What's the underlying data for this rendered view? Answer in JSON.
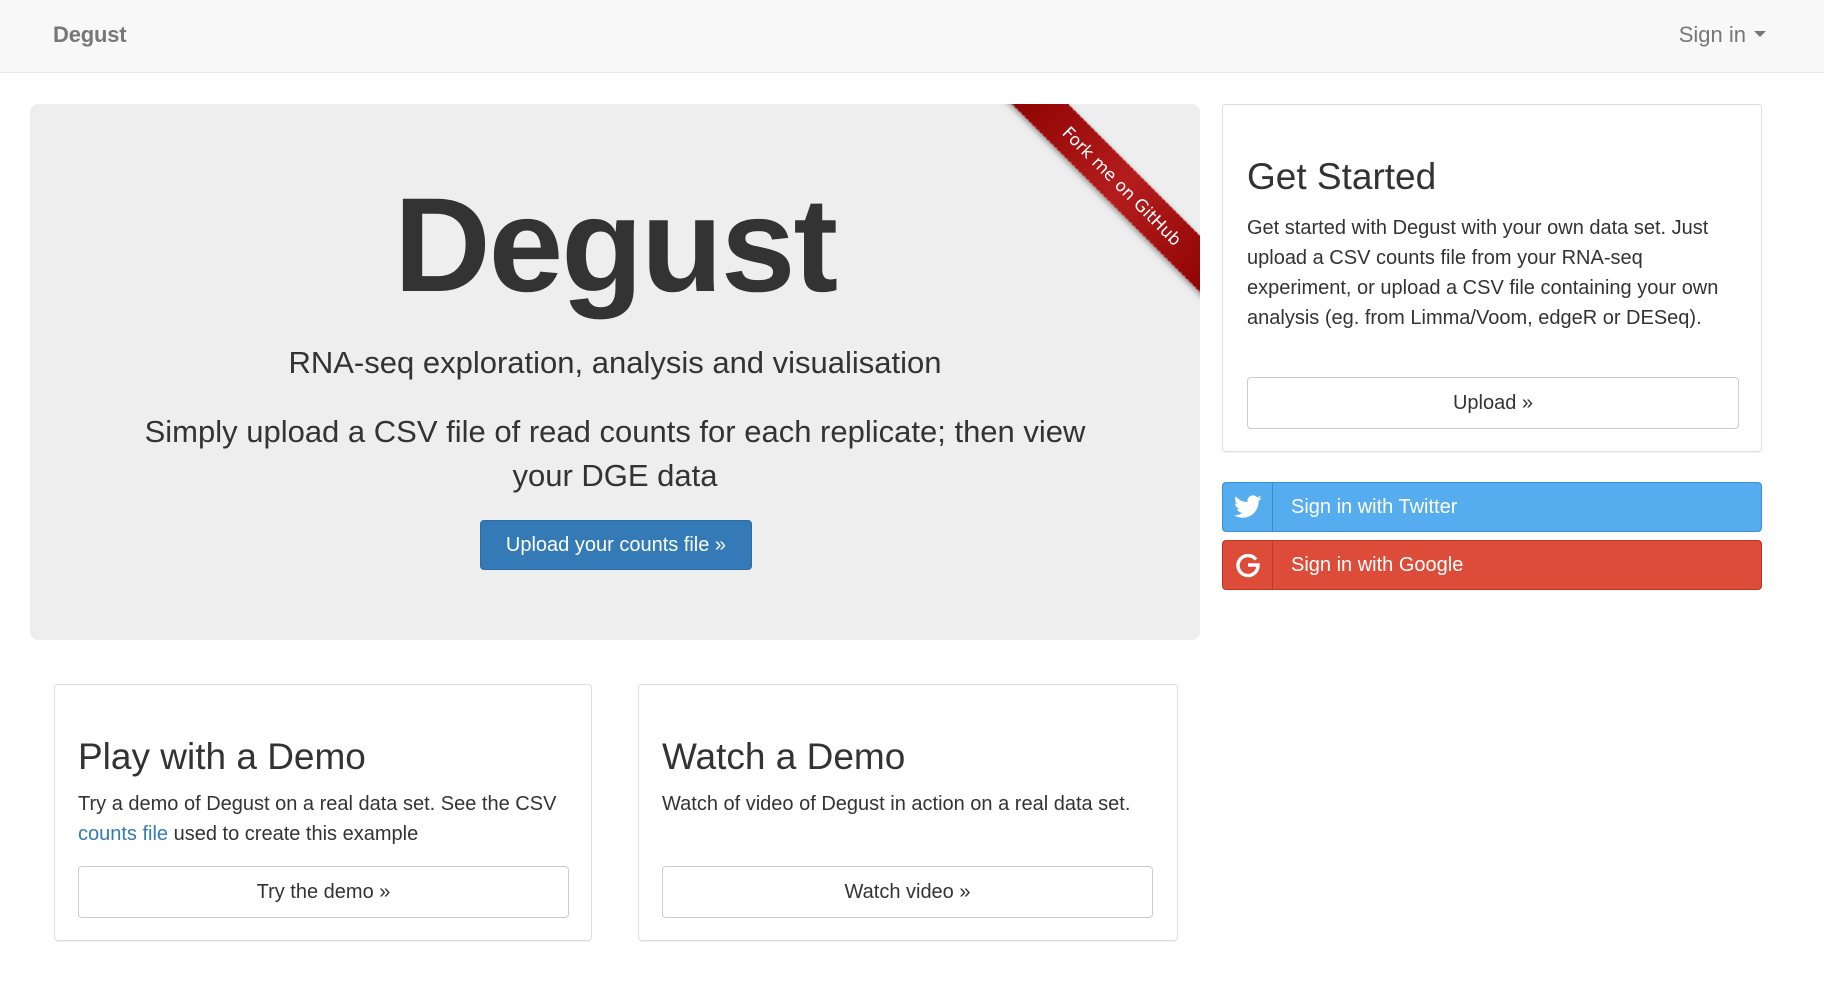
{
  "navbar": {
    "brand": "Degust",
    "signin_label": "Sign in"
  },
  "jumbotron": {
    "title": "Degust",
    "subtitle": "RNA-seq exploration, analysis and visualisation",
    "description": "Simply upload a CSV file of read counts for each replicate; then view your DGE data",
    "upload_button": "Upload your counts file »",
    "ribbon": "Fork me on GitHub"
  },
  "get_started": {
    "title": "Get Started",
    "text": "Get started with Degust with your own data set. Just upload a CSV counts file from your RNA-seq experiment, or upload a CSV file containing your own analysis (eg. from Limma/Voom, edgeR or DESeq).",
    "button": "Upload »"
  },
  "social": {
    "twitter_label": "Sign in with Twitter",
    "google_label": "Sign in with Google"
  },
  "play_demo": {
    "title": "Play with a Demo",
    "text_before": "Try a demo of Degust on a real data set. See the CSV ",
    "link": "counts file",
    "text_after": " used to create this example",
    "button": "Try the demo »"
  },
  "watch_demo": {
    "title": "Watch a Demo",
    "text": "Watch of video of Degust in action on a real data set.",
    "button": "Watch video »"
  },
  "colors": {
    "primary": "#337ab7",
    "twitter": "#55acee",
    "google": "#dd4b39",
    "ribbon": "#aa0000"
  }
}
